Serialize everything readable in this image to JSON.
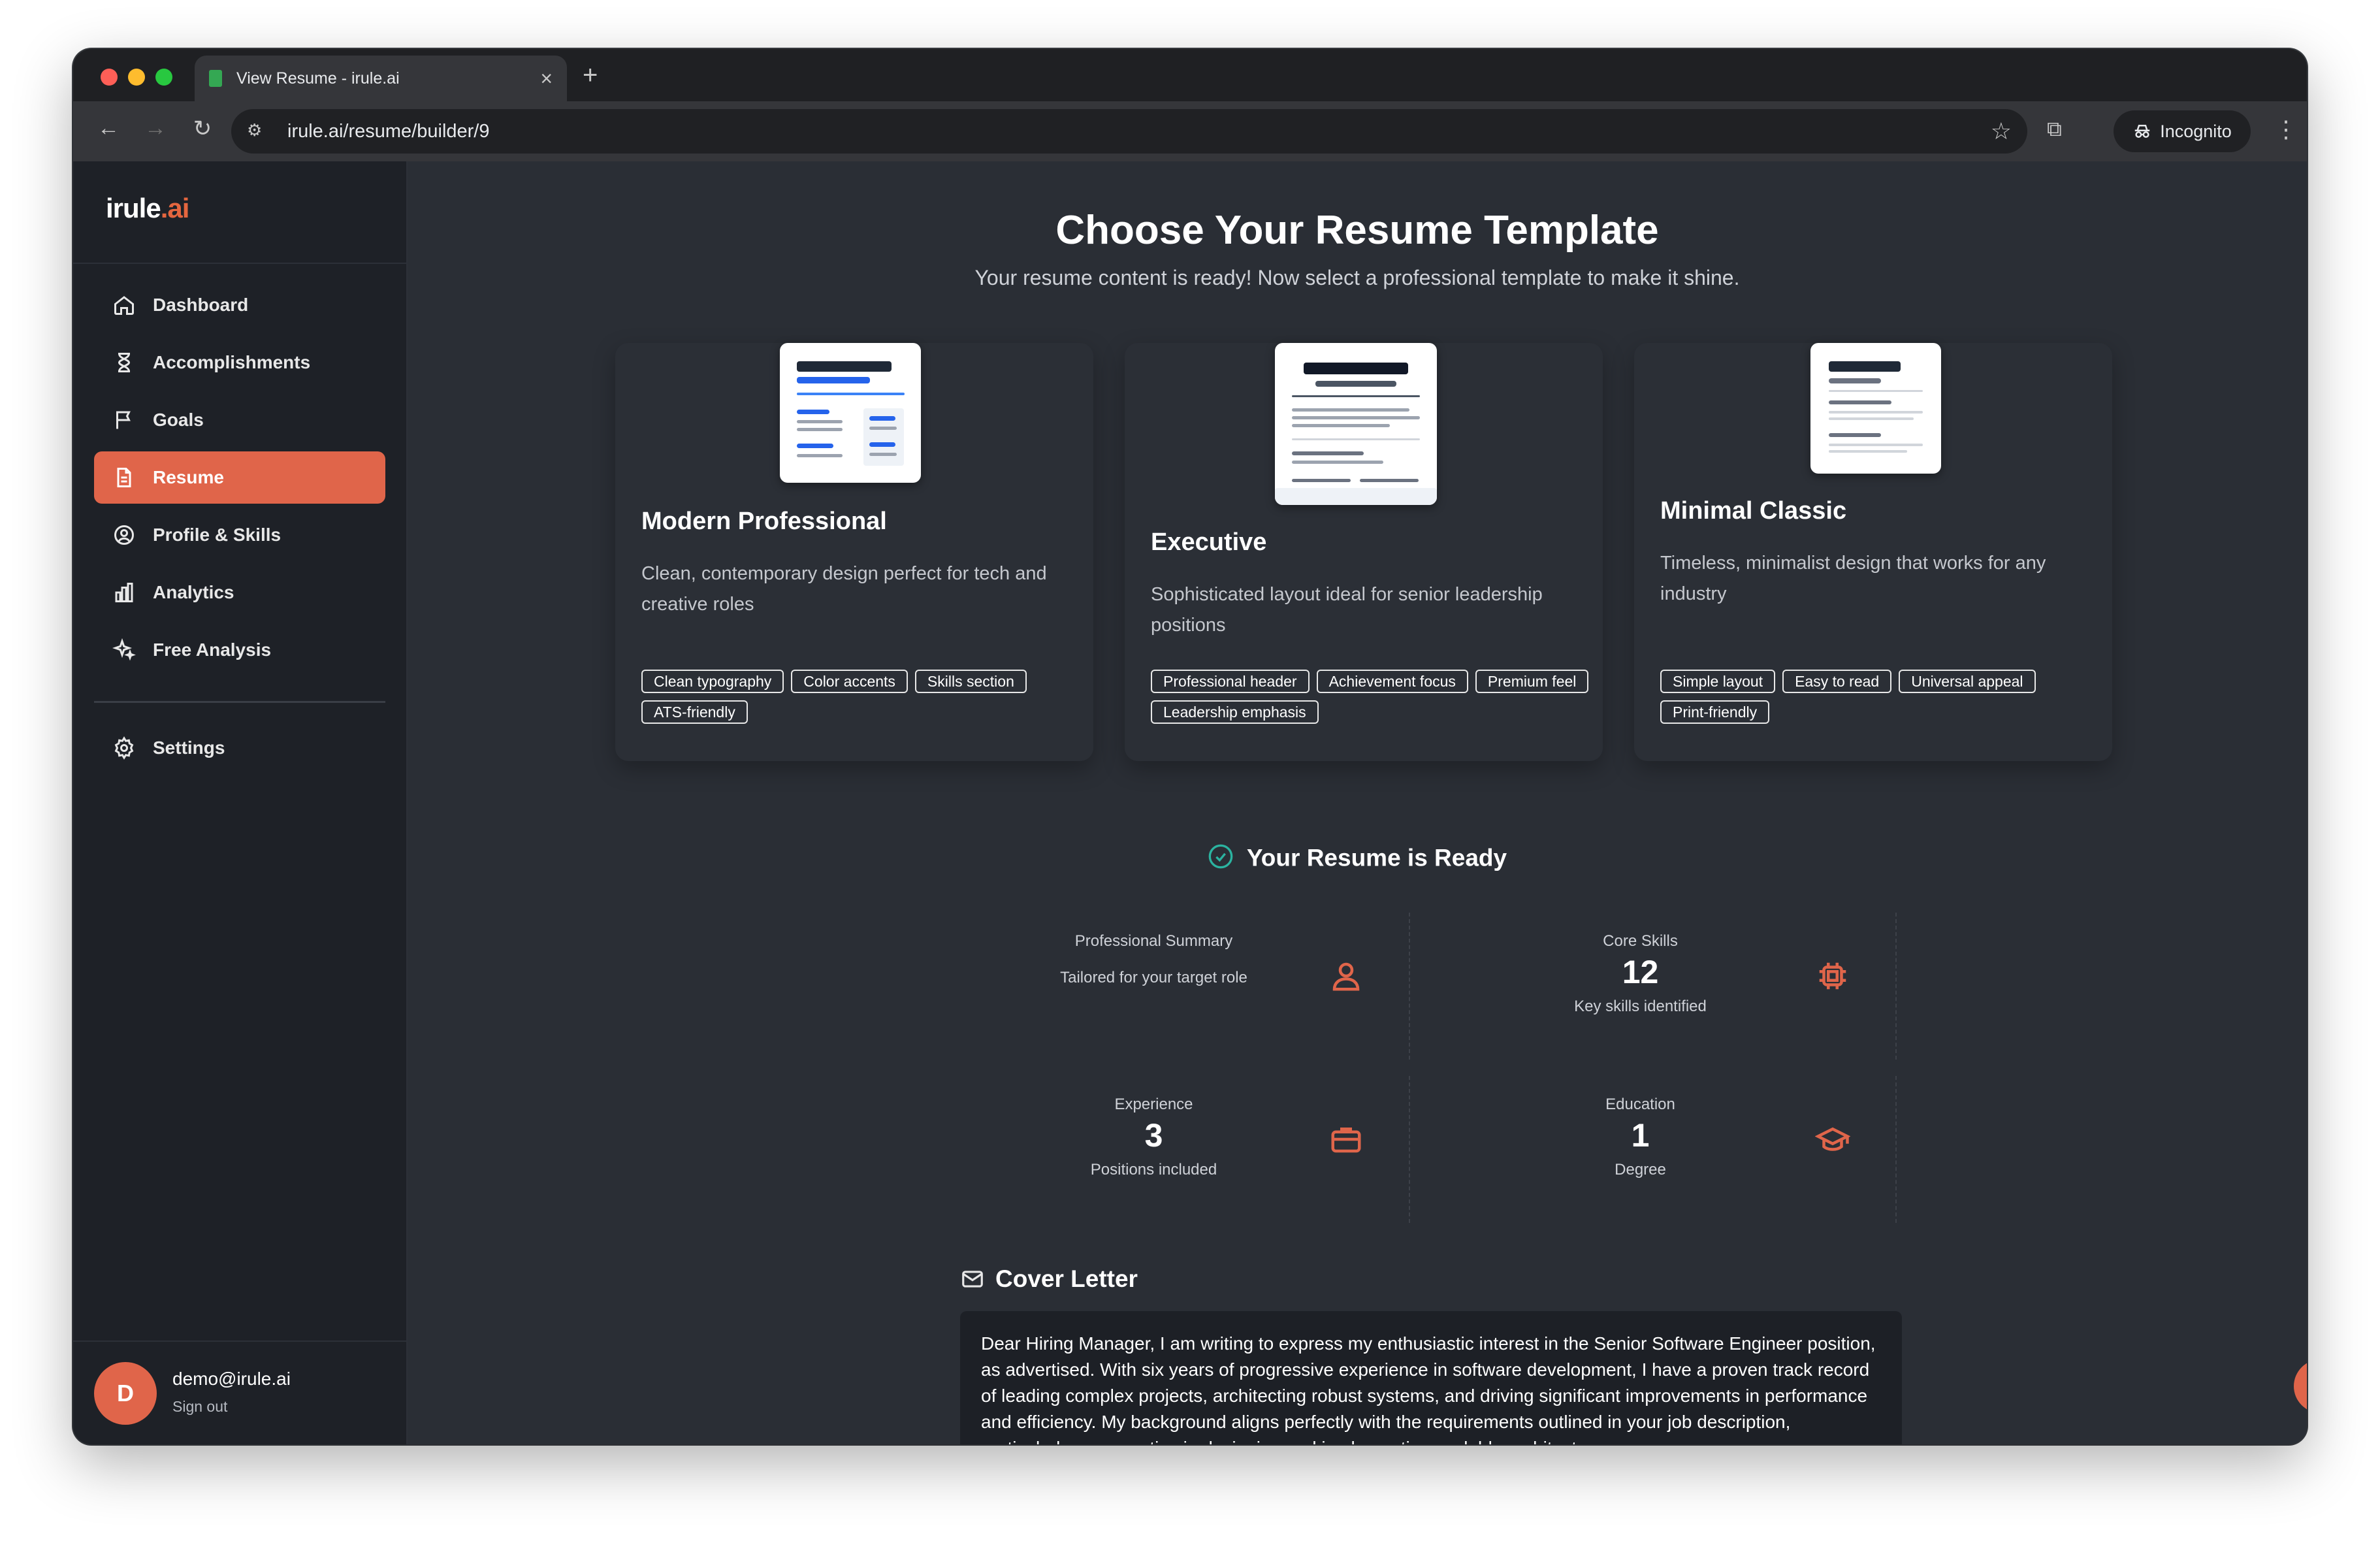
{
  "browser": {
    "tab_title": "View Resume - irule.ai",
    "url": "irule.ai/resume/builder/9",
    "incognito_label": "Incognito",
    "traffic_lights": [
      "#fe5f57",
      "#febc2e",
      "#28c840"
    ]
  },
  "sidebar": {
    "logo_main": "irule",
    "logo_accent": ".ai",
    "items": [
      {
        "label": "Dashboard",
        "icon": "home-icon"
      },
      {
        "label": "Accomplishments",
        "icon": "hourglass-icon"
      },
      {
        "label": "Goals",
        "icon": "flag-icon"
      },
      {
        "label": "Resume",
        "icon": "document-icon",
        "active": true
      },
      {
        "label": "Profile & Skills",
        "icon": "user-circle-icon"
      },
      {
        "label": "Analytics",
        "icon": "bar-chart-icon"
      },
      {
        "label": "Free Analysis",
        "icon": "sparkles-icon"
      }
    ],
    "settings_label": "Settings",
    "user": {
      "initial": "D",
      "email": "demo@irule.ai",
      "signout": "Sign out"
    }
  },
  "main": {
    "title": "Choose Your Resume Template",
    "subtitle": "Your resume content is ready! Now select a professional template to make it shine.",
    "templates": [
      {
        "name": "Modern Professional",
        "description": "Clean, contemporary design perfect for tech and creative roles",
        "tags": [
          "Clean typography",
          "Color accents",
          "Skills section",
          "ATS-friendly"
        ]
      },
      {
        "name": "Executive",
        "description": "Sophisticated layout ideal for senior leadership positions",
        "tags": [
          "Professional header",
          "Achievement focus",
          "Premium feel",
          "Leadership emphasis"
        ]
      },
      {
        "name": "Minimal Classic",
        "description": "Timeless, minimalist design that works for any industry",
        "tags": [
          "Simple layout",
          "Easy to read",
          "Universal appeal",
          "Print-friendly"
        ]
      }
    ],
    "ready_title": "Your Resume is Ready",
    "stats": {
      "summary": {
        "label": "Professional Summary",
        "desc": "Tailored for your target role"
      },
      "skills": {
        "label": "Core Skills",
        "value": "12",
        "desc": "Key skills identified"
      },
      "experience": {
        "label": "Experience",
        "value": "3",
        "desc": "Positions included"
      },
      "education": {
        "label": "Education",
        "value": "1",
        "desc": "Degree"
      }
    },
    "cover_letter": {
      "title": "Cover Letter",
      "text": "Dear Hiring Manager, I am writing to express my enthusiastic interest in the Senior Software Engineer position, as advertised. With six years of progressive experience in software development, I have a proven track record of leading complex projects, architecting robust systems, and driving significant improvements in performance and efficiency. My background aligns perfectly with the requirements outlined in your job description, particularly my expertise in designing and implementing scalable architectures."
    }
  },
  "colors": {
    "accent": "#e0654a",
    "background": "#2a2e35",
    "sidebar": "#1e2127"
  }
}
